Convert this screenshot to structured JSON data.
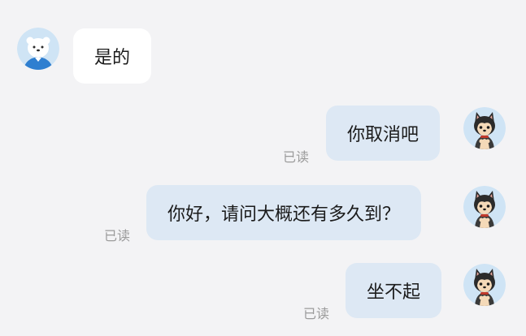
{
  "messages": [
    {
      "direction": "incoming",
      "text": "是的",
      "avatar": "polar-bear-avatar"
    },
    {
      "direction": "outgoing",
      "text": "你取消吧",
      "status": "已读",
      "avatar": "shiba-dog-avatar"
    },
    {
      "direction": "outgoing",
      "text": "你好，请问大概还有多久到？",
      "status": "已读",
      "avatar": "shiba-dog-avatar"
    },
    {
      "direction": "outgoing",
      "text": "坐不起",
      "status": "已读",
      "avatar": "shiba-dog-avatar"
    }
  ],
  "colors": {
    "background": "#f3f3f5",
    "incoming_bubble": "#ffffff",
    "outgoing_bubble": "#dde8f4",
    "read_receipt": "#9b9b9b"
  }
}
